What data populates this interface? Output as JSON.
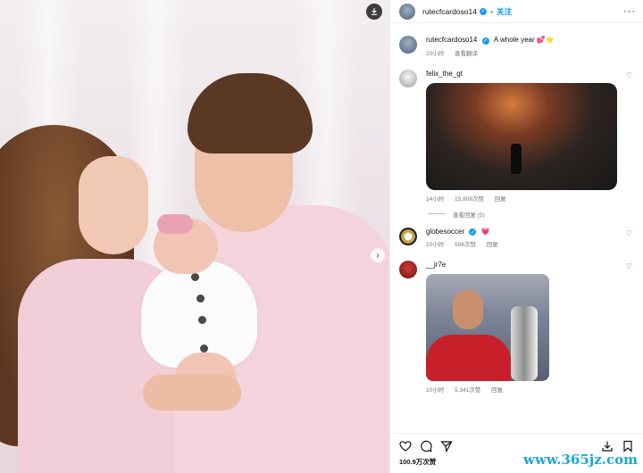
{
  "post": {
    "author": "rutecfcardoso14",
    "follow_label": "关注",
    "more_label": "···",
    "caption_text": "A whole year 💕⭐",
    "time": "20小时",
    "translate_label": "查看翻译"
  },
  "comments": [
    {
      "user": "felix_the_gt",
      "time": "14小时",
      "likes": "15,809次赞",
      "reply_label": "回复",
      "view_replies": "查看回复 (5)"
    },
    {
      "user": "globesoccer",
      "text": "💗",
      "time": "10小时",
      "likes": "506次赞",
      "reply_label": "回复"
    },
    {
      "user": "__jr7e",
      "time": "10小时",
      "likes": "5,341次赞",
      "reply_label": "回复"
    }
  ],
  "footer": {
    "likes_count": "100.9万次赞"
  },
  "watermark": "www.365jz.com",
  "colors": {
    "accent": "#0095f6",
    "verified": "#1d9bf0"
  }
}
